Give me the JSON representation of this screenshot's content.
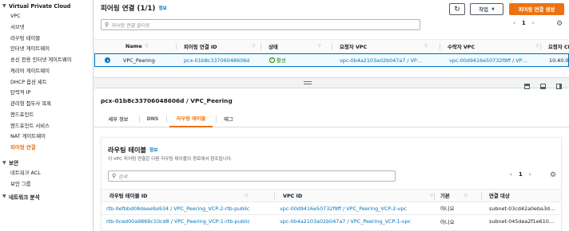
{
  "sidebar": {
    "vpc_section": "Virtual Private Cloud",
    "items": [
      "VPC",
      "서브넷",
      "라우팅 테이블",
      "인터넷 게이트웨이",
      "송신 전용 인터넷 게이트웨이",
      "캐리어 게이트웨이",
      "DHCP 옵션 세트",
      "탄력적 IP",
      "관리형 접두사 목록",
      "엔드포인트",
      "엔드포인트 서비스",
      "NAT 게이트웨이",
      "피어링 연결"
    ],
    "security_section": "보안",
    "security_items": [
      "네트워크 ACL",
      "보안 그룹"
    ],
    "analysis_section": "네트워크 분석"
  },
  "header": {
    "title": "피어링 연결 (1/1)",
    "info": "정보",
    "actions_label": "작업",
    "create_label": "피어링 연결 생성"
  },
  "search": {
    "placeholder": "피어링 연결 필터링"
  },
  "pager": {
    "page": "1"
  },
  "table": {
    "columns": [
      "Name",
      "피어링 연결 ID",
      "상태",
      "요청자 VPC",
      "수락자 VPC",
      "요청자 CI"
    ],
    "row": {
      "name": "VPC_Peering",
      "id": "pcx-01b8c33706048606d",
      "status": "활성",
      "requester_vpc": "vpc-0b4a2103a02b047a7 / VP…",
      "accepter_vpc": "vpc-00d9416e50732f9ff / VP…",
      "requester_cidr": "10.40.0."
    }
  },
  "detail": {
    "title": "pcx-01b8c33706048606d / VPC_Peering",
    "tabs": [
      "세부 정보",
      "DNS",
      "라우팅 테이블",
      "태그"
    ]
  },
  "route_tables": {
    "title": "라우팅 테이블",
    "info": "정보",
    "description": "이 VPC 피어링 연결은 다음 라우팅 테이블의 경로에서 참조됩니다.",
    "search_placeholder": "검색",
    "page": "1",
    "columns": [
      "라우팅 테이블 ID",
      "VPC ID",
      "기본",
      "연결 대상"
    ],
    "rows": [
      {
        "rt": "rtb-0efbbd08deee9a934 / VPC_Peering_VCP-2-rtb-public",
        "vpc": "vpc-00d9416e50732f9ff / VPC_Peering_VCP-2-vpc",
        "main": "아니요",
        "assoc": "subnet-03cd42a0eba3d…"
      },
      {
        "rt": "rtb-0ced00a9869c10cd8 / VPC_Peering_VCP-1-rtb-public",
        "vpc": "vpc-0b4a2103a02b047a7 / VPC_Peering_VCP-1-vpc",
        "main": "아니요",
        "assoc": "subnet-045dea2f1e610…"
      }
    ]
  },
  "colors": {
    "accent": "#ec7211",
    "link": "#0073bb",
    "success": "#1d8102"
  }
}
